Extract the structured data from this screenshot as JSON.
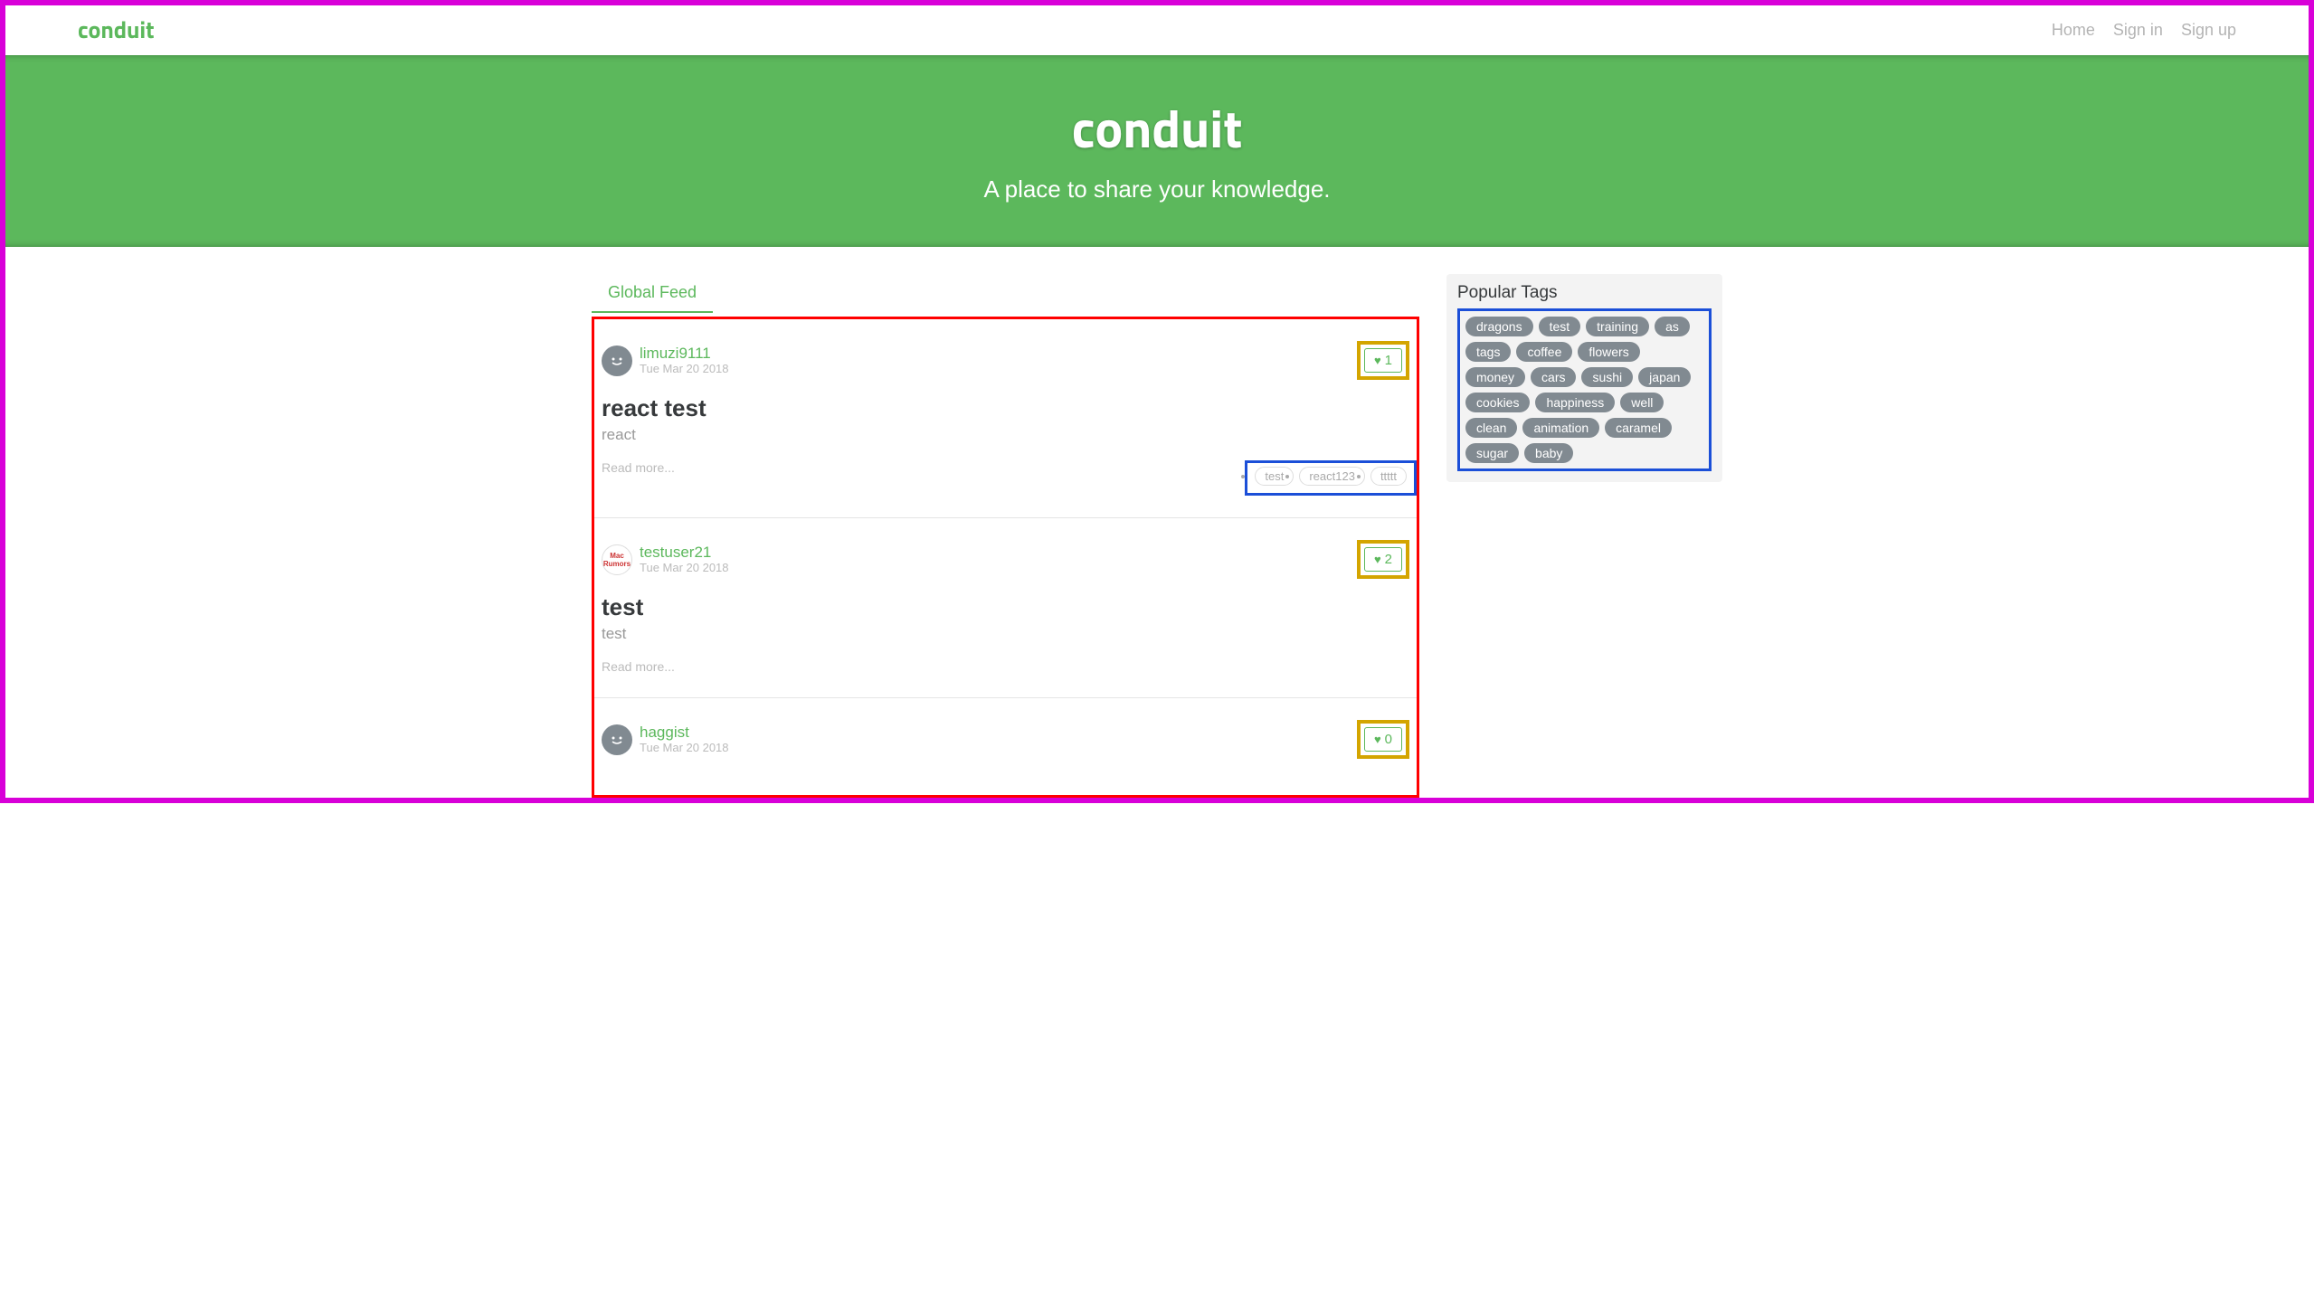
{
  "brand": "conduit",
  "nav": {
    "home": "Home",
    "signin": "Sign in",
    "signup": "Sign up"
  },
  "banner": {
    "title": "conduit",
    "subtitle": "A place to share your knowledge."
  },
  "feed": {
    "tab_global": "Global Feed"
  },
  "articles": [
    {
      "author": "limuzi9111",
      "date": "Tue Mar 20 2018",
      "likes": "1",
      "title": "react test",
      "desc": "react",
      "readmore": "Read more...",
      "tags": [
        "test",
        "react123",
        "ttttt"
      ],
      "avatar_type": "smiley"
    },
    {
      "author": "testuser21",
      "date": "Tue Mar 20 2018",
      "likes": "2",
      "title": "test",
      "desc": "test",
      "readmore": "Read more...",
      "tags": [],
      "avatar_type": "macrumors"
    },
    {
      "author": "haggist",
      "date": "Tue Mar 20 2018",
      "likes": "0",
      "title": "",
      "desc": "",
      "readmore": "",
      "tags": [],
      "avatar_type": "smiley"
    }
  ],
  "sidebar": {
    "title": "Popular Tags",
    "tags": [
      "dragons",
      "test",
      "training",
      "as",
      "tags",
      "coffee",
      "flowers",
      "money",
      "cars",
      "sushi",
      "japan",
      "cookies",
      "happiness",
      "well",
      "clean",
      "animation",
      "caramel",
      "sugar",
      "baby"
    ]
  }
}
